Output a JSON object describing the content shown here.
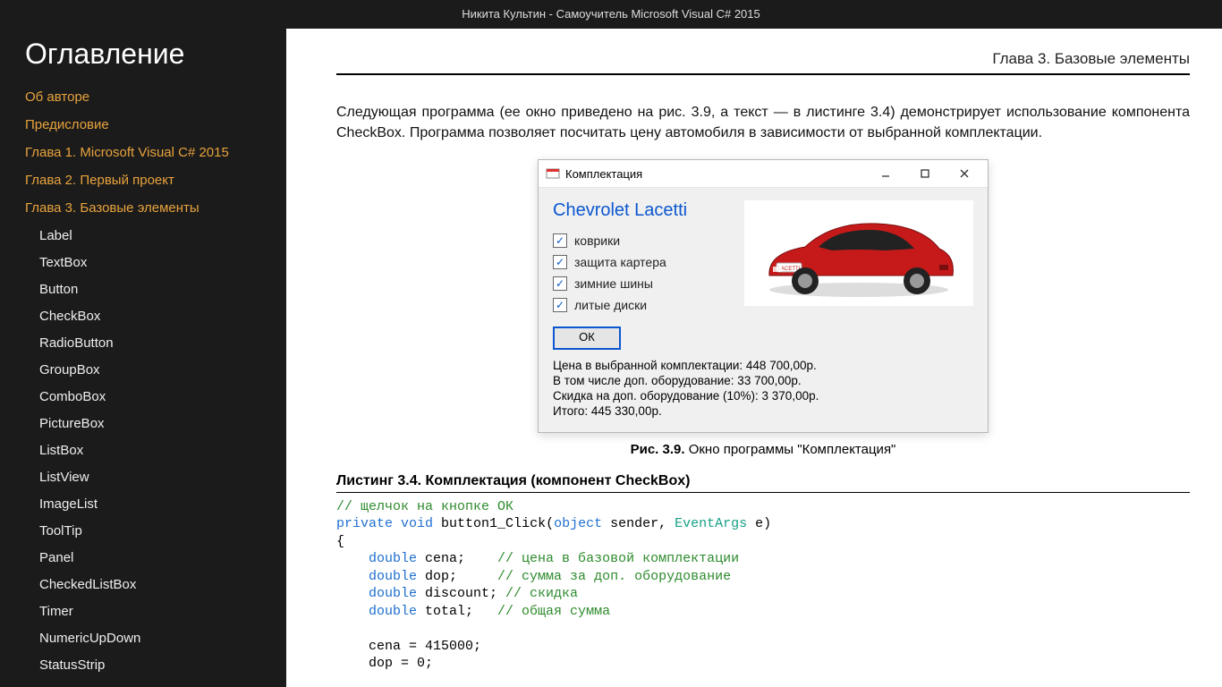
{
  "window_title": "Никита Культин - Самоучитель Microsoft Visual C# 2015",
  "sidebar": {
    "heading": "Оглавление",
    "chapters": [
      "Об авторе",
      "Предисловие",
      "Глава 1. Microsoft Visual C# 2015",
      "Глава 2. Первый проект",
      "Глава 3. Базовые элементы"
    ],
    "ch3_subs": [
      "Label",
      "TextBox",
      "Button",
      "CheckBox",
      "RadioButton",
      "GroupBox",
      "ComboBox",
      "PictureBox",
      "ListBox",
      "ListView",
      "ImageList",
      "ToolTip",
      "Panel",
      "CheckedListBox",
      "Timer",
      "NumericUpDown",
      "StatusStrip"
    ]
  },
  "chapter_header": "Глава 3. Базовые элементы",
  "paragraph": "Следующая программа (ее окно приведено на рис. 3.9, а текст — в листинге 3.4) демонстрирует использование компонента CheckBox. Программа позволяет посчитать цену автомобиля в зависимости от выбранной комплектации.",
  "winform": {
    "title": "Комплектация",
    "car_name": "Chevrolet Lacetti",
    "checks": [
      "коврики",
      "защита картера",
      "зимние шины",
      "литые диски"
    ],
    "ok_label": "ОК",
    "info": [
      "Цена в выбранной комплектации: 448 700,00р.",
      "В том числе доп. оборудование: 33 700,00р.",
      "Скидка на доп. оборудование (10%): 3 370,00р.",
      "Итого: 445 330,00р."
    ],
    "car_badge": "LACETTI"
  },
  "figcap_bold": "Рис. 3.9.",
  "figcap_rest": " Окно программы \"Комплектация\"",
  "listing_title": "Листинг 3.4. Комплектация (компонент CheckBox)",
  "code": {
    "l1_comment": "// щелчок на кнопке ОК",
    "kw_private": "private",
    "kw_void": "void",
    "fn": " button1_Click(",
    "kw_object": "object",
    "mid1": " sender, ",
    "type_eventargs": "EventArgs",
    "mid2": " e)",
    "brace_open": "{",
    "kw_double": "double",
    "v1": " cena;    ",
    "c1": "// цена в базовой комплектации",
    "v2": " dop;     ",
    "c2": "// сумма за доп. оборудование",
    "v3": " discount;",
    "c3": " // скидка",
    "v4": " total;   ",
    "c4": "// общая сумма",
    "assign1": "    cena = 415000;",
    "assign2": "    dop = 0;"
  }
}
